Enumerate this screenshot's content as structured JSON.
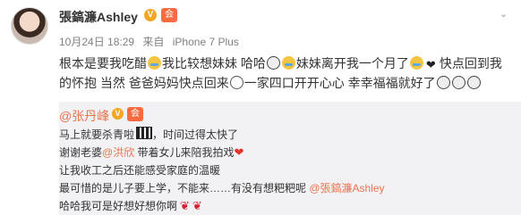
{
  "post": {
    "username": "張鎬濂Ashley",
    "verified_badge": "V",
    "member_badge": "会",
    "menu_icon": "chevron-down-icon",
    "date": "10月24日 18:29",
    "source_prefix": "来自",
    "source": "iPhone 7 Plus",
    "text": {
      "p1": "根本是要我吃醋",
      "p2": "我比较想妹妹 哈哈",
      "p3": "妹妹离开我一个月了",
      "p4": "快点回到我的怀抱 当然 爸爸妈妈快点回来",
      "p5": "一家四口开开心心 幸幸福福就好了"
    }
  },
  "repost": {
    "author": "@张丹峰",
    "verified_badge": "V",
    "member_badge": "会",
    "lines": {
      "l1": "马上就要杀青啦",
      "l1b": "，时间过得太快了",
      "l2a": "谢谢老婆",
      "l2m": "@洪欣",
      "l2b": " 带着女儿来陪我拍戏",
      "l3": "让我收工之后还能感受家庭的温暖",
      "l4a": "最可惜的是儿子要上学，不能来……有没有想粑粑呢 ",
      "l4m": "@張鎬濂Ashley",
      "l5": "哈哈我可是好想好想你啊"
    }
  }
}
